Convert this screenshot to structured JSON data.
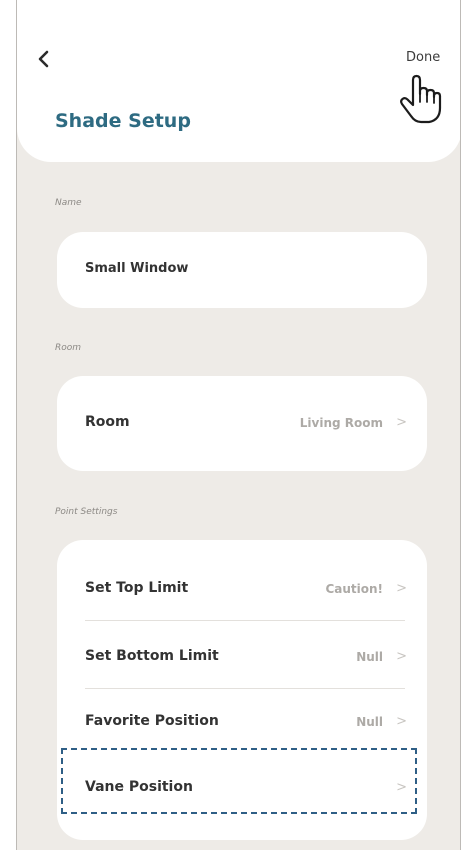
{
  "header": {
    "title": "Shade Setup",
    "done_label": "Done"
  },
  "sections": {
    "name_label": "Name",
    "room_label": "Room",
    "point_settings_label": "Point Settings"
  },
  "name": {
    "value": "Small Window"
  },
  "room": {
    "label": "Room",
    "value": "Living Room"
  },
  "point_settings": {
    "rows": [
      {
        "label": "Set Top Limit",
        "value": "Caution!"
      },
      {
        "label": "Set Bottom Limit",
        "value": "Null"
      },
      {
        "label": "Favorite Position",
        "value": "Null"
      },
      {
        "label": "Vane Position",
        "value": ""
      }
    ]
  },
  "icons": {
    "back": "chevron-left-icon",
    "cursor": "hand-pointer-icon",
    "row_chevron": "chevron-right-icon"
  },
  "colors": {
    "title": "#2e6b82",
    "background": "#eeebe7",
    "card": "#ffffff",
    "highlight_dash": "#2f5f86"
  }
}
